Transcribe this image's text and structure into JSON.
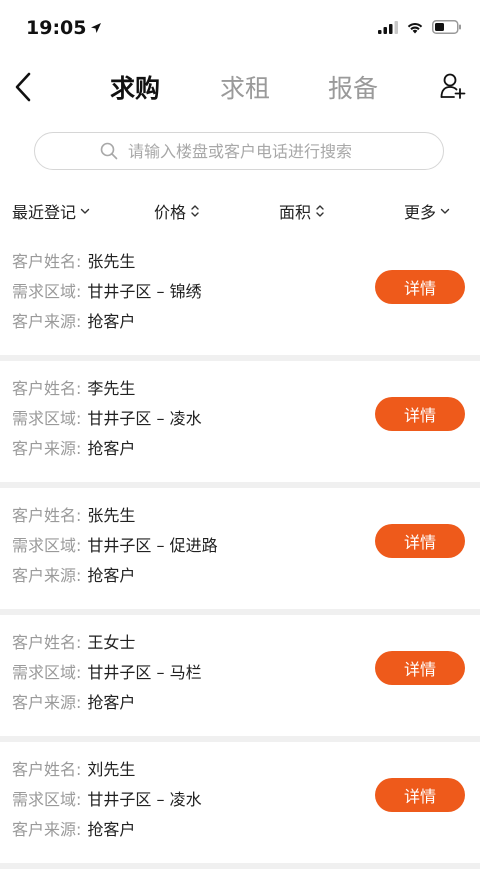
{
  "status_bar": {
    "time": "19:05"
  },
  "nav": {
    "tabs": [
      {
        "label": "求购",
        "active": true
      },
      {
        "label": "求租",
        "active": false
      },
      {
        "label": "报备",
        "active": false
      }
    ]
  },
  "search": {
    "placeholder": "请输入楼盘或客户电话进行搜索",
    "value": ""
  },
  "filters": [
    {
      "label": "最近登记",
      "icon": "chevron-down-icon"
    },
    {
      "label": "价格",
      "icon": "sort-icon"
    },
    {
      "label": "面积",
      "icon": "sort-icon"
    },
    {
      "label": "更多",
      "icon": "chevron-down-icon"
    }
  ],
  "labels": {
    "name": "客户姓名:",
    "area": "需求区域:",
    "source": "客户来源:",
    "detail_button": "详情"
  },
  "customers": [
    {
      "name": "张先生",
      "area": "甘井子区 – 锦绣",
      "source": "抢客户"
    },
    {
      "name": "李先生",
      "area": "甘井子区 – 凌水",
      "source": "抢客户"
    },
    {
      "name": "张先生",
      "area": "甘井子区 – 促进路",
      "source": "抢客户"
    },
    {
      "name": "王女士",
      "area": "甘井子区 – 马栏",
      "source": "抢客户"
    },
    {
      "name": "刘先生",
      "area": "甘井子区 – 凌水",
      "source": "抢客户"
    }
  ],
  "colors": {
    "accent": "#ee5a1b",
    "label_gray": "#9a9a9a",
    "divider": "#f0f0f0"
  }
}
